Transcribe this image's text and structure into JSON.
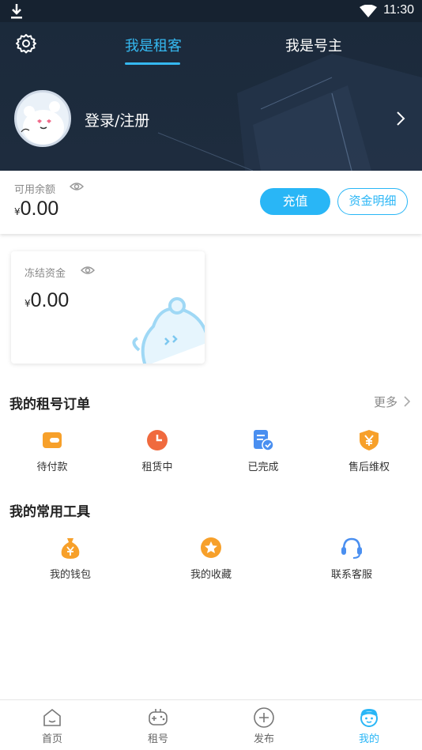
{
  "status_bar": {
    "time": "11:30"
  },
  "header": {
    "tabs": [
      {
        "label": "我是租客",
        "active": true
      },
      {
        "label": "我是号主",
        "active": false
      }
    ],
    "login_text": "登录/注册"
  },
  "balance": {
    "label": "可用余额",
    "currency": "¥",
    "amount": "0.00",
    "recharge_label": "充值",
    "detail_label": "资金明细"
  },
  "frozen": {
    "label": "冻结资金",
    "currency": "¥",
    "amount": "0.00"
  },
  "orders": {
    "title": "我的租号订单",
    "more_label": "更多",
    "items": [
      {
        "label": "待付款",
        "icon": "wallet-icon"
      },
      {
        "label": "租赁中",
        "icon": "clock-icon"
      },
      {
        "label": "已完成",
        "icon": "document-check-icon"
      },
      {
        "label": "售后维权",
        "icon": "shield-yen-icon"
      }
    ]
  },
  "tools": {
    "title": "我的常用工具",
    "items": [
      {
        "label": "我的钱包",
        "icon": "money-bag-icon"
      },
      {
        "label": "我的收藏",
        "icon": "star-icon"
      },
      {
        "label": "联系客服",
        "icon": "headset-icon"
      }
    ]
  },
  "bottom_nav": {
    "items": [
      {
        "label": "首页",
        "icon": "home-icon",
        "active": false
      },
      {
        "label": "租号",
        "icon": "gamepad-icon",
        "active": false
      },
      {
        "label": "发布",
        "icon": "plus-circle-icon",
        "active": false
      },
      {
        "label": "我的",
        "icon": "profile-face-icon",
        "active": true
      }
    ]
  },
  "colors": {
    "accent": "#29b6f6",
    "header_bg": "#1b2a3b",
    "orange": "#f7a02a",
    "red_orange": "#f06a3e"
  }
}
